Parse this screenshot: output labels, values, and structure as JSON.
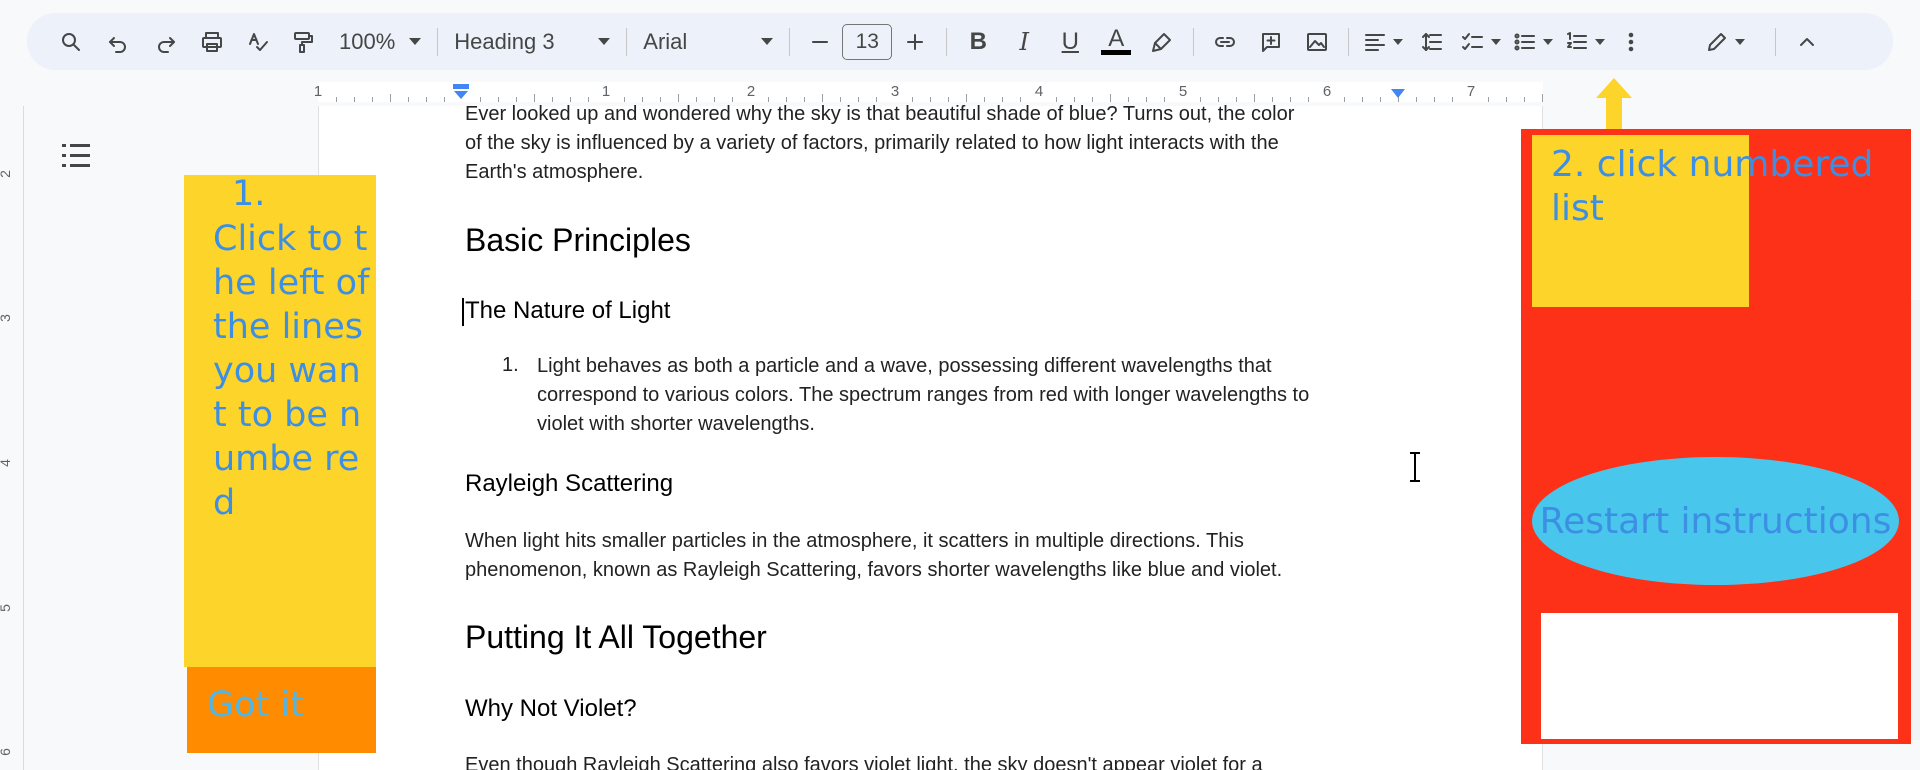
{
  "toolbar": {
    "zoom": "100%",
    "style": "Heading 3",
    "font": "Arial",
    "font_size": "13",
    "bold_letter": "B",
    "italic_letter": "I",
    "underline_letter": "U",
    "text_color_letter": "A"
  },
  "ruler": {
    "numbers": [
      "1",
      "1",
      "2",
      "3",
      "4",
      "5",
      "6",
      "7"
    ],
    "vertical_numbers": [
      "2",
      "3",
      "4",
      "5",
      "6"
    ]
  },
  "document": {
    "intro": [
      "Ever looked up and wondered why the sky is that beautiful shade of blue? Turns out, the color",
      "of the sky is influenced by a variety of factors, primarily related to how light interacts with the",
      "Earth's atmosphere."
    ],
    "h_basic": "Basic Principles",
    "h_nature": "The Nature of Light",
    "list_number": "1.",
    "list_item": [
      "Light behaves as both a particle and a wave, possessing different wavelengths that",
      "correspond to various colors. The spectrum ranges from red with longer wavelengths to",
      "violet with shorter wavelengths."
    ],
    "h_rayleigh": "Rayleigh Scattering",
    "rayleigh_text": [
      "When light hits smaller particles in the atmosphere, it scatters in multiple directions. This",
      "phenomenon, known as Rayleigh Scattering, favors shorter wavelengths like blue and violet."
    ],
    "h_together": "Putting It All Together",
    "h_violet": "Why Not Violet?",
    "violet_text": "Even though Rayleigh Scattering also favors violet light, the sky doesn't appear violet for a"
  },
  "overlay": {
    "step1_number": "1.",
    "step1_text": "Click to the left of the lines you want to be numbe red",
    "got_it": "Got it",
    "step2_text": "2. click numbered list",
    "restart": "Restart instructions"
  },
  "colors": {
    "tip_yellow": "#fdd42a",
    "tip_orange": "#ff8b00",
    "panel_red": "#fd3018",
    "restart_cyan": "#48c6ec",
    "tip_text_blue": "#3d8fe3",
    "toolbar_bg": "#edf2fa"
  },
  "icons": [
    "search-icon",
    "undo-icon",
    "redo-icon",
    "print-icon",
    "spellcheck-icon",
    "paint-format-icon",
    "minus-icon",
    "plus-icon",
    "highlighter-icon",
    "link-icon",
    "add-comment-icon",
    "image-icon",
    "align-left-icon",
    "line-spacing-icon",
    "checklist-icon",
    "bulleted-list-icon",
    "numbered-list-icon",
    "more-vert-icon",
    "edit-mode-icon",
    "collapse-icon",
    "outline-icon"
  ]
}
